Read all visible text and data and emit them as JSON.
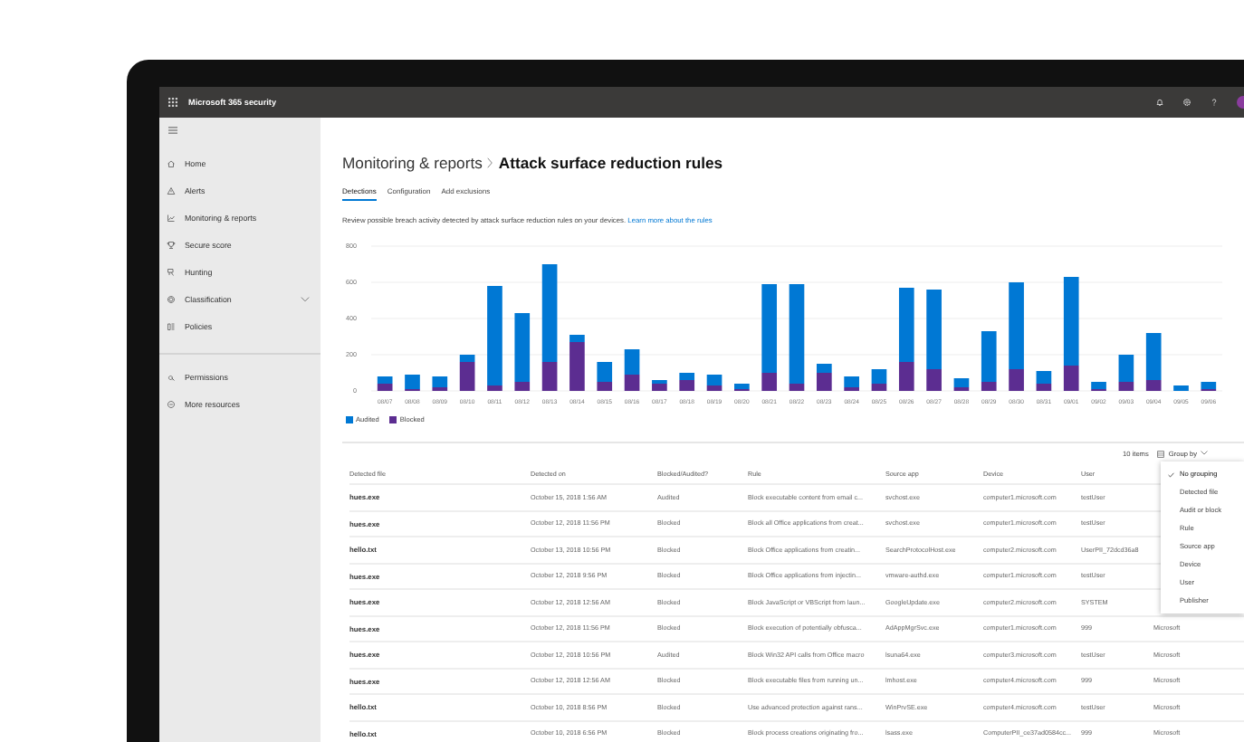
{
  "topbar": {
    "title": "Microsoft 365 security"
  },
  "sidebar": {
    "items": [
      {
        "label": "Home",
        "expandable": false
      },
      {
        "label": "Alerts",
        "expandable": false
      },
      {
        "label": "Monitoring & reports",
        "expandable": false
      },
      {
        "label": "Secure score",
        "expandable": false
      },
      {
        "label": "Hunting",
        "expandable": false
      },
      {
        "label": "Classification",
        "expandable": true
      },
      {
        "label": "Policies",
        "expandable": false
      }
    ],
    "secondary_items": [
      {
        "label": "Permissions",
        "expandable": false
      },
      {
        "label": "More resources",
        "expandable": false
      }
    ]
  },
  "breadcrumb": {
    "parent": "Monitoring & reports",
    "title": "Attack surface reduction rules"
  },
  "tabs": [
    {
      "label": "Detections",
      "selected": true
    },
    {
      "label": "Configuration",
      "selected": false
    },
    {
      "label": "Add exclusions",
      "selected": false
    }
  ],
  "description": {
    "text": "Review possible breach activity detected by attack surface reduction rules on your devices.",
    "link": "Learn more about the rules"
  },
  "chart": {
    "chart_data": {
      "type": "bar",
      "stacked": true,
      "grid": true,
      "legend": "bottom-left",
      "ylim": [
        0,
        800
      ],
      "yticks": [
        0,
        200,
        400,
        600,
        800
      ],
      "categories": [
        "08/07",
        "08/08",
        "08/09",
        "08/10",
        "08/11",
        "08/12",
        "08/13",
        "08/14",
        "08/15",
        "08/16",
        "08/17",
        "08/18",
        "08/19",
        "08/20",
        "08/21",
        "08/22",
        "08/23",
        "08/24",
        "08/25",
        "08/26",
        "08/27",
        "08/28",
        "08/29",
        "08/30",
        "08/31",
        "09/01",
        "09/02",
        "09/03",
        "09/04",
        "09/05",
        "09/06"
      ],
      "series": [
        {
          "name": "Audited",
          "color": "#0078d4",
          "values": [
            40,
            80,
            60,
            40,
            550,
            380,
            540,
            40,
            110,
            140,
            20,
            40,
            60,
            30,
            490,
            550,
            50,
            60,
            80,
            410,
            440,
            50,
            280,
            480,
            70,
            490,
            40,
            150,
            260,
            30,
            40
          ]
        },
        {
          "name": "Blocked",
          "color": "#5c2d91",
          "values": [
            40,
            10,
            20,
            160,
            30,
            50,
            160,
            270,
            50,
            90,
            40,
            60,
            30,
            10,
            100,
            40,
            100,
            20,
            40,
            160,
            120,
            20,
            50,
            120,
            40,
            140,
            10,
            50,
            60,
            0,
            10
          ]
        }
      ]
    }
  },
  "toolbar": {
    "count": "10 items",
    "group_by": "Group by"
  },
  "group_menu": {
    "items": [
      {
        "label": "No grouping",
        "selected": true
      },
      {
        "label": "Detected file",
        "selected": false
      },
      {
        "label": "Audit or block",
        "selected": false
      },
      {
        "label": "Rule",
        "selected": false
      },
      {
        "label": "Source app",
        "selected": false
      },
      {
        "label": "Device",
        "selected": false
      },
      {
        "label": "User",
        "selected": false
      },
      {
        "label": "Publisher",
        "selected": false
      }
    ]
  },
  "table": {
    "columns": [
      "Detected file",
      "Detected on",
      "Blocked/Audited?",
      "Rule",
      "Source app",
      "Device",
      "User"
    ],
    "rows": [
      {
        "file": "hues.exe",
        "detected_on": "October 15, 2018 1:56 AM",
        "action": "Audited",
        "rule": "Block executable content from email c...",
        "source_app": "svchost.exe",
        "device": "computer1.microsoft.com",
        "user": "testUser"
      },
      {
        "file": "hues.exe",
        "detected_on": "October 12, 2018 11:56 PM",
        "action": "Blocked",
        "rule": "Block all Office applications from creat...",
        "source_app": "svchost.exe",
        "device": "computer1.microsoft.com",
        "user": "testUser"
      },
      {
        "file": "hello.txt",
        "detected_on": "October 13, 2018 10:56 PM",
        "action": "Blocked",
        "rule": "Block Office applications from creatin...",
        "source_app": "SearchProtocolHost.exe",
        "device": "computer2.microsoft.com",
        "user": "UserPII_72dcd36a8"
      },
      {
        "file": "hues.exe",
        "detected_on": "October 12, 2018 9:56 PM",
        "action": "Blocked",
        "rule": "Block Office applications from injectin...",
        "source_app": "vmware-authd.exe",
        "device": "computer1.microsoft.com",
        "user": "testUser"
      },
      {
        "file": "hues.exe",
        "detected_on": "October 12, 2018 12:56 AM",
        "action": "Blocked",
        "rule": "Block JavaScript or VBScript from laun...",
        "source_app": "GoogleUpdate.exe",
        "device": "computer2.microsoft.com",
        "user": "SYSTEM"
      },
      {
        "file": "hues.exe",
        "detected_on": "October 12, 2018 11:56 PM",
        "action": "Blocked",
        "rule": "Block execution of potentially obfusca...",
        "source_app": "AdAppMgrSvc.exe",
        "device": "computer1.microsoft.com",
        "user": "999",
        "column_8": "Microsoft"
      },
      {
        "file": "hues.exe",
        "detected_on": "October 12, 2018 10:56 PM",
        "action": "Audited",
        "rule": "Block Win32 API calls from Office macro",
        "source_app": "lsuna64.exe",
        "device": "computer3.microsoft.com",
        "user": "testUser",
        "column_8": "Microsoft"
      },
      {
        "file": "hues.exe",
        "detected_on": "October 12, 2018 12:56 AM",
        "action": "Blocked",
        "rule": "Block executable files from running un...",
        "source_app": "lmhost.exe",
        "device": "computer4.microsoft.com",
        "user": "999",
        "column_8": "Microsoft"
      },
      {
        "file": "hello.txt",
        "detected_on": "October 10, 2018 8:56 PM",
        "action": "Blocked",
        "rule": "Use advanced protection against rans...",
        "source_app": "WinPrvSE.exe",
        "device": "computer4.microsoft.com",
        "user": "testUser",
        "column_8": "Microsoft"
      },
      {
        "file": "hello.txt",
        "detected_on": "October 10, 2018 6:56 PM",
        "action": "Blocked",
        "rule": "Block process creations originating fro...",
        "source_app": "lsass.exe",
        "device": "ComputerPII_ce37ad0584cc...",
        "user": "999",
        "column_8": "Microsoft"
      }
    ]
  }
}
